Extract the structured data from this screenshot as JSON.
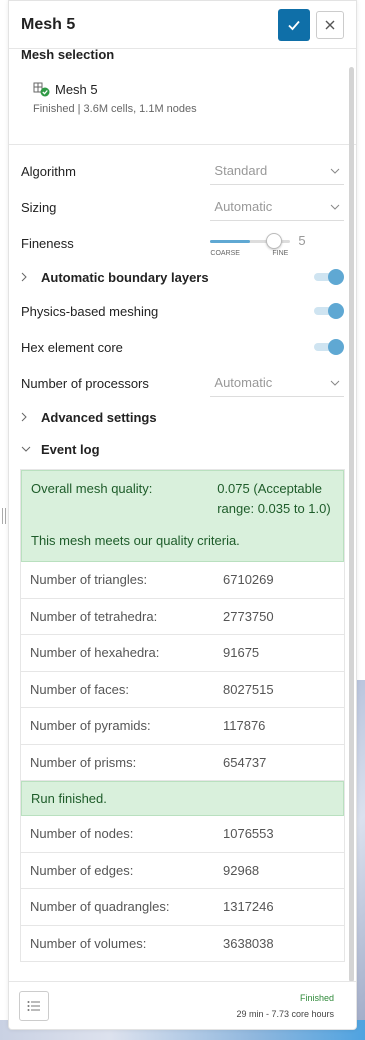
{
  "header": {
    "title": "Mesh 5"
  },
  "mesh_selection": {
    "title": "Mesh selection",
    "name": "Mesh 5",
    "subtitle": "Finished | 3.6M cells, 1.1M nodes"
  },
  "settings": {
    "algorithm": {
      "label": "Algorithm",
      "value": "Standard"
    },
    "sizing": {
      "label": "Sizing",
      "value": "Automatic"
    },
    "fineness": {
      "label": "Fineness",
      "value": "5",
      "min_label": "COARSE",
      "max_label": "FINE",
      "level": 0.5
    },
    "boundary_layers": {
      "label": "Automatic boundary layers",
      "enabled": true
    },
    "physics_meshing": {
      "label": "Physics-based meshing",
      "enabled": true
    },
    "hex_core": {
      "label": "Hex element core",
      "enabled": true
    },
    "processors": {
      "label": "Number of processors",
      "value": "Automatic"
    },
    "advanced": {
      "label": "Advanced settings"
    },
    "event_log": {
      "label": "Event log"
    }
  },
  "event_log": {
    "quality_key": "Overall mesh quality:",
    "quality_value": "0.075 (Acceptable range: 0.035 to 1.0)",
    "quality_message": "This mesh meets our quality criteria.",
    "rows_a": [
      {
        "k": "Number of triangles:",
        "v": "6710269"
      },
      {
        "k": "Number of tetrahedra:",
        "v": "2773750"
      },
      {
        "k": "Number of hexahedra:",
        "v": "91675"
      },
      {
        "k": "Number of faces:",
        "v": "8027515"
      },
      {
        "k": "Number of pyramids:",
        "v": "117876"
      },
      {
        "k": "Number of prisms:",
        "v": "654737"
      }
    ],
    "run_finished": "Run finished.",
    "rows_b": [
      {
        "k": "Number of nodes:",
        "v": "1076553"
      },
      {
        "k": "Number of edges:",
        "v": "92968"
      },
      {
        "k": "Number of quadrangles:",
        "v": "1317246"
      },
      {
        "k": "Number of volumes:",
        "v": "3638038"
      }
    ]
  },
  "footer": {
    "status": "Finished",
    "duration": "29 min - 7.73 core hours"
  },
  "colors": {
    "accent": "#0f6fa8",
    "success_bg": "#d9f0dc",
    "toggle": "#5fa8d3"
  }
}
